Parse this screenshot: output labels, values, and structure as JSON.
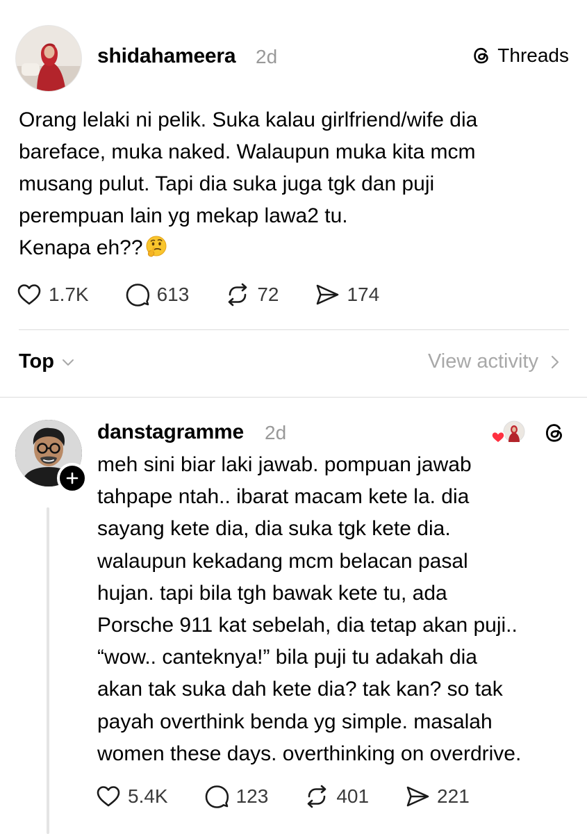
{
  "brand": {
    "label": "Threads"
  },
  "post": {
    "username": "shidahameera",
    "time": "2d",
    "lines": [
      "Orang lelaki ni pelik. Suka kalau girlfriend/wife dia",
      "bareface, muka naked. Walaupun muka kita mcm",
      "musang pulut. Tapi dia suka juga tgk dan puji",
      "perempuan lain yg mekap lawa2 tu.",
      "Kenapa eh??"
    ],
    "emoji": "thinking-face",
    "likes": "1.7K",
    "replies": "613",
    "reposts": "72",
    "shares": "174"
  },
  "sort": {
    "label": "Top",
    "view_activity": "View activity"
  },
  "reply": {
    "username": "danstagramme",
    "time": "2d",
    "lines": [
      "meh sini biar laki jawab. pompuan jawab",
      "tahpape ntah.. ibarat macam kete la. dia",
      "sayang kete dia, dia suka tgk kete dia.",
      "walaupun kekadang mcm belacan pasal",
      "hujan. tapi bila tgh bawak kete tu, ada",
      "Porsche 911 kat sebelah, dia tetap akan puji..",
      "“wow.. canteknya!” bila puji tu adakah dia",
      "akan tak suka dah kete dia? tak kan? so tak",
      "payah overthink benda yg simple. masalah",
      "women these days. overthinking on overdrive."
    ],
    "likes": "5.4K",
    "replies": "123",
    "reposts": "401",
    "shares": "221"
  },
  "colors": {
    "text": "#000000",
    "muted": "#999999",
    "divider": "#dcdcdc",
    "heart_red": "#ff3040"
  }
}
